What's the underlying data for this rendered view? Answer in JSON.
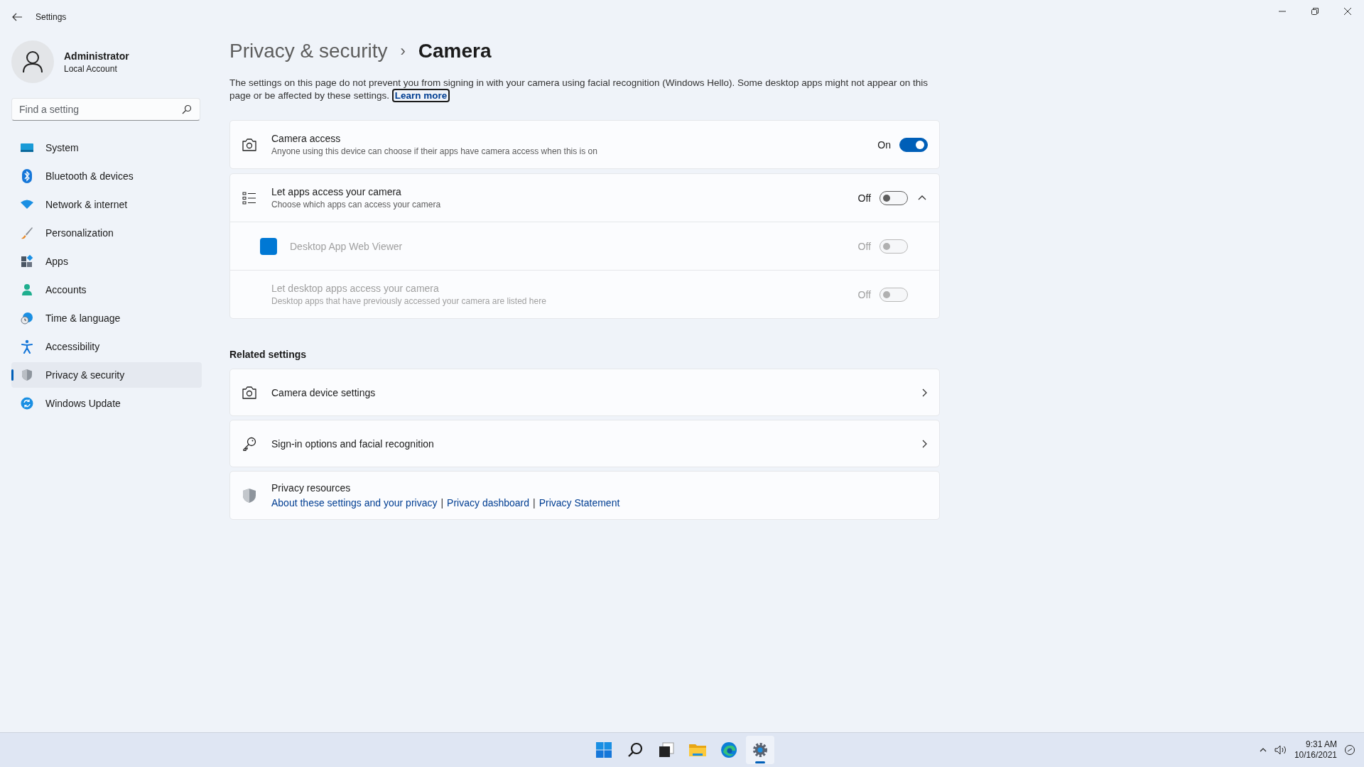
{
  "window": {
    "title": "Settings"
  },
  "user": {
    "name": "Administrator",
    "account": "Local Account"
  },
  "search": {
    "placeholder": "Find a setting"
  },
  "sidebar": {
    "items": [
      {
        "kind": "system",
        "label": "System",
        "selected": false
      },
      {
        "kind": "bluetooth",
        "label": "Bluetooth & devices",
        "selected": false
      },
      {
        "kind": "network",
        "label": "Network & internet",
        "selected": false
      },
      {
        "kind": "personalization",
        "label": "Personalization",
        "selected": false
      },
      {
        "kind": "apps",
        "label": "Apps",
        "selected": false
      },
      {
        "kind": "accounts",
        "label": "Accounts",
        "selected": false
      },
      {
        "kind": "time",
        "label": "Time & language",
        "selected": false
      },
      {
        "kind": "accessibility",
        "label": "Accessibility",
        "selected": false
      },
      {
        "kind": "privacy",
        "label": "Privacy & security",
        "selected": true
      },
      {
        "kind": "update",
        "label": "Windows Update",
        "selected": false
      }
    ]
  },
  "breadcrumb": {
    "parent": "Privacy & security",
    "separator": "›",
    "current": "Camera"
  },
  "description": {
    "text": "The settings on this page do not prevent you from signing in with your camera using facial recognition (Windows Hello). Some desktop apps might not appear on this page or be affected by these settings.",
    "link": "Learn more"
  },
  "camera_access": {
    "title": "Camera access",
    "subtitle": "Anyone using this device can choose if their apps have camera access when this is on",
    "state_label": "On",
    "on": true
  },
  "app_access": {
    "title": "Let apps access your camera",
    "subtitle": "Choose which apps can access your camera",
    "state_label": "Off",
    "on": false,
    "expanded": true,
    "rows": [
      {
        "kind": "app",
        "title": "Desktop App Web Viewer",
        "state_label": "Off",
        "on": false,
        "disabled": true
      },
      {
        "kind": "setting",
        "title": "Let desktop apps access your camera",
        "subtitle": "Desktop apps that have previously accessed your camera are listed here",
        "state_label": "Off",
        "on": false,
        "disabled": true
      }
    ]
  },
  "related": {
    "heading": "Related settings",
    "items": [
      {
        "kind": "camera",
        "label": "Camera device settings"
      },
      {
        "kind": "key",
        "label": "Sign-in options and facial recognition"
      }
    ]
  },
  "privacy_resources": {
    "title": "Privacy resources",
    "separator": "|",
    "links": [
      "About these settings and your privacy",
      "Privacy dashboard",
      "Privacy Statement"
    ]
  },
  "taskbar": {
    "items": [
      {
        "kind": "start",
        "selected": false
      },
      {
        "kind": "search",
        "selected": false
      },
      {
        "kind": "taskview",
        "selected": false
      },
      {
        "kind": "explorer",
        "selected": false
      },
      {
        "kind": "edge",
        "selected": false
      },
      {
        "kind": "settings",
        "selected": true
      }
    ],
    "time": "9:31 AM",
    "date": "10/16/2021"
  }
}
